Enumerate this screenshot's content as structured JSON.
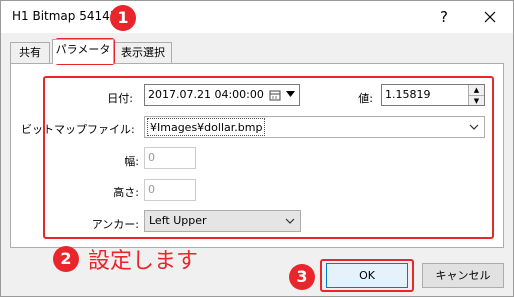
{
  "window": {
    "title": "H1 Bitmap 54143",
    "help_glyph": "?",
    "close_glyph": "×"
  },
  "tabs": [
    {
      "label": "共有",
      "active": false
    },
    {
      "label": "パラメータ",
      "active": true
    },
    {
      "label": "表示選択",
      "active": false
    }
  ],
  "form": {
    "date_label": "日付:",
    "date_value": "2017.07.21 04:00:00",
    "price_label": "値:",
    "price_value": "1.15819",
    "bitmap_label": "ビットマップファイル:",
    "bitmap_value": "¥Images¥dollar.bmp",
    "width_label": "幅:",
    "width_value": "0",
    "height_label": "高さ:",
    "height_value": "0",
    "anchor_label": "アンカー:",
    "anchor_value": "Left Upper"
  },
  "annotations": {
    "badge1": "1",
    "badge2": "2",
    "badge3": "3",
    "note2": "設定します",
    "color": "#e8262c"
  },
  "buttons": {
    "ok_label": "OK",
    "cancel_label": "キャンセル"
  }
}
